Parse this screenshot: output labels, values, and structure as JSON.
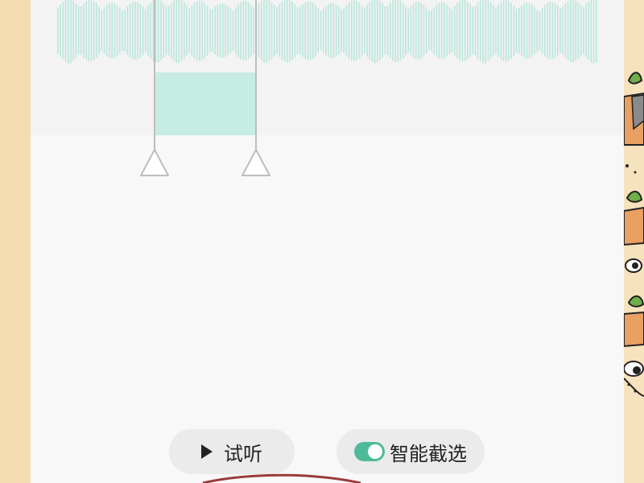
{
  "editor": {
    "waveform_color": "#b9e6dc",
    "selection_color": "#c7ece3",
    "handle_color": "#bdbdbd"
  },
  "controls": {
    "listen_label": "试听",
    "smart_select_label": "智能截选",
    "smart_select_enabled": true,
    "toggle_color": "#4fba9a"
  },
  "colors": {
    "background_border": "#f3ddb0",
    "panel_background": "#f8f8f8",
    "waveform_band": "#f3f3f3",
    "pill_background": "#ebebeb"
  }
}
